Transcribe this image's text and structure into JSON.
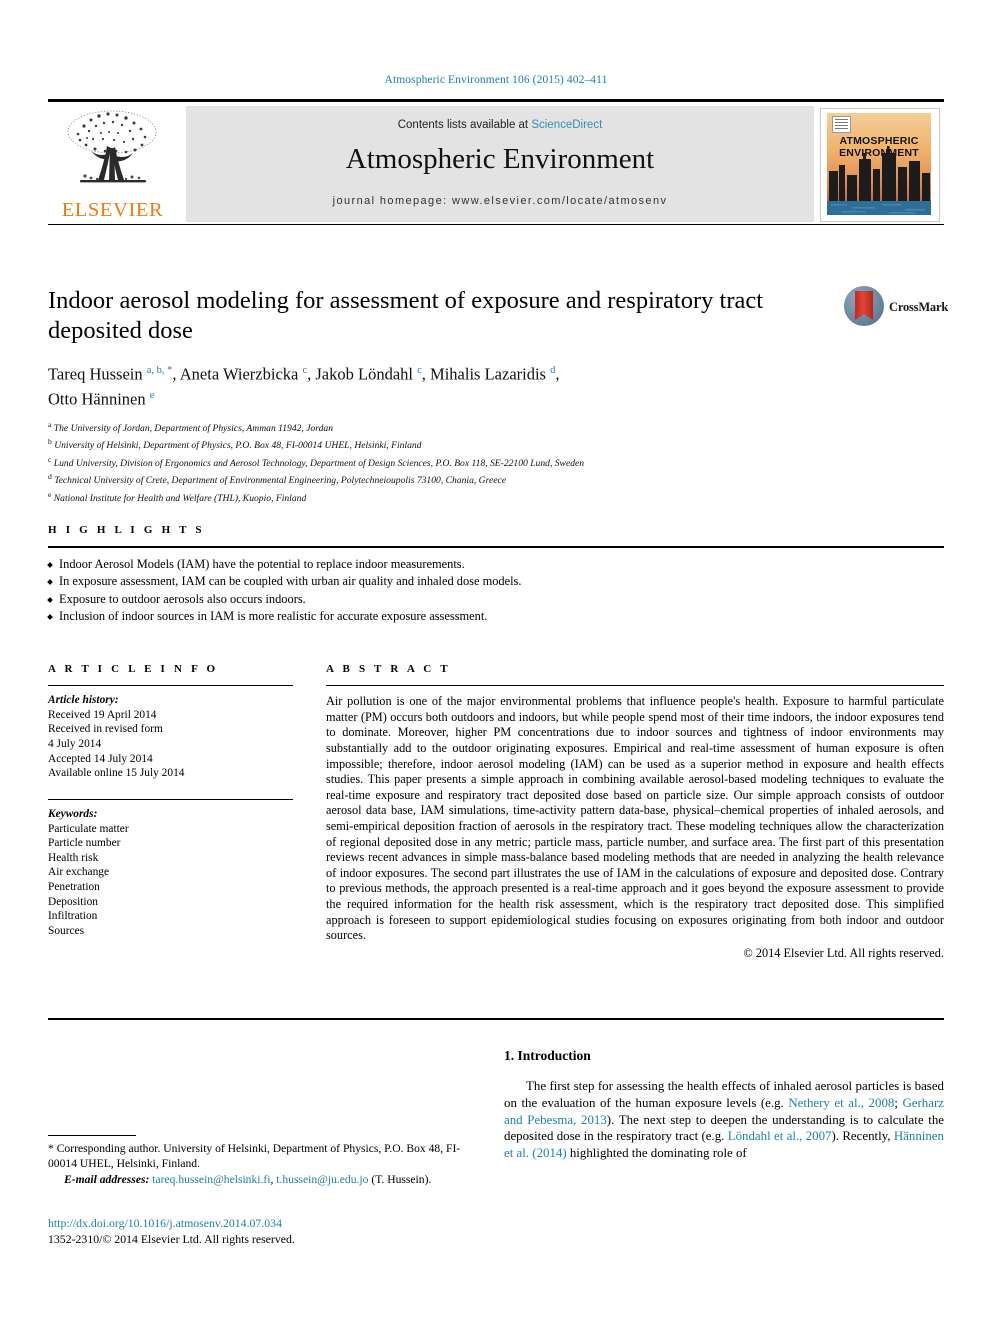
{
  "running_head": "Atmospheric Environment 106 (2015) 402–411",
  "masthead": {
    "publisher_name": "ELSEVIER",
    "contents_prefix": "Contents lists available at ",
    "contents_link": "ScienceDirect",
    "journal_title": "Atmospheric Environment",
    "journal_homepage": "journal homepage: www.elsevier.com/locate/atmosenv",
    "cover_title_line1": "ATMOSPHERIC",
    "cover_title_line2": "ENVIRONMENT"
  },
  "article": {
    "title": "Indoor aerosol modeling for assessment of exposure and respiratory tract deposited dose",
    "crossmark_label": "CrossMark",
    "authors_html": "Tareq Hussein <sup>a, b, *</sup>, Aneta Wierzbicka <sup>c</sup>, Jakob Löndahl <sup>c</sup>, Mihalis Lazaridis <sup>d</sup>,<br>Otto Hänninen <sup>e</sup>",
    "affiliations": [
      {
        "label": "a",
        "text": "The University of Jordan, Department of Physics, Amman 11942, Jordan"
      },
      {
        "label": "b",
        "text": "University of Helsinki, Department of Physics, P.O. Box 48, FI-00014 UHEL, Helsinki, Finland"
      },
      {
        "label": "c",
        "text": "Lund University, Division of Ergonomics and Aerosol Technology, Department of Design Sciences, P.O. Box 118, SE-22100 Lund, Sweden"
      },
      {
        "label": "d",
        "text": "Technical University of Crete, Department of Environmental Engineering, Polytechneioupolis 73100, Chania, Greece"
      },
      {
        "label": "e",
        "text": "National Institute for Health and Welfare (THL), Kuopio, Finland"
      }
    ]
  },
  "highlights": {
    "heading": "H I G H L I G H T S",
    "items": [
      "Indoor Aerosol Models (IAM) have the potential to replace indoor measurements.",
      "In exposure assessment, IAM can be coupled with urban air quality and inhaled dose models.",
      "Exposure to outdoor aerosols also occurs indoors.",
      "Inclusion of indoor sources in IAM is more realistic for accurate exposure assessment."
    ]
  },
  "article_info": {
    "heading": "A R T I C L E   I N F O",
    "history_label": "Article history:",
    "history": [
      "Received 19 April 2014",
      "Received in revised form",
      "4 July 2014",
      "Accepted 14 July 2014",
      "Available online 15 July 2014"
    ],
    "keywords_label": "Keywords:",
    "keywords": [
      "Particulate matter",
      "Particle number",
      "Health risk",
      "Air exchange",
      "Penetration",
      "Deposition",
      "Infiltration",
      "Sources"
    ]
  },
  "abstract": {
    "heading": "A B S T R A C T",
    "text": "Air pollution is one of the major environmental problems that influence people's health. Exposure to harmful particulate matter (PM) occurs both outdoors and indoors, but while people spend most of their time indoors, the indoor exposures tend to dominate. Moreover, higher PM concentrations due to indoor sources and tightness of indoor environments may substantially add to the outdoor originating exposures. Empirical and real-time assessment of human exposure is often impossible; therefore, indoor aerosol modeling (IAM) can be used as a superior method in exposure and health effects studies. This paper presents a simple approach in combining available aerosol-based modeling techniques to evaluate the real-time exposure and respiratory tract deposited dose based on particle size. Our simple approach consists of outdoor aerosol data base, IAM simulations, time-activity pattern data-base, physical–chemical properties of inhaled aerosols, and semi-empirical deposition fraction of aerosols in the respiratory tract. These modeling techniques allow the characterization of regional deposited dose in any metric; particle mass, particle number, and surface area. The first part of this presentation reviews recent advances in simple mass-balance based modeling methods that are needed in analyzing the health relevance of indoor exposures. The second part illustrates the use of IAM in the calculations of exposure and deposited dose. Contrary to previous methods, the approach presented is a real-time approach and it goes beyond the exposure assessment to provide the required information for the health risk assessment, which is the respiratory tract deposited dose. This simplified approach is foreseen to support epidemiological studies focusing on exposures originating from both indoor and outdoor sources.",
    "copyright": "© 2014 Elsevier Ltd. All rights reserved."
  },
  "introduction": {
    "heading": "1.  Introduction",
    "paragraph_html": "The first step for assessing the health effects of inhaled aerosol particles is based on the evaluation of the human exposure levels (e.g. <span class=\"cit\">Nethery et al., 2008</span>; <span class=\"cit\">Gerharz and Pebesma, 2013</span>). The next step to deepen the understanding is to calculate the deposited dose in the respiratory tract (e.g. <span class=\"cit\">Löndahl et al., 2007</span>). Recently, <span class=\"cit\">Hänninen et al. (2014)</span> highlighted the dominating role of"
  },
  "footnotes": {
    "corresponding_html": "* Corresponding author. University of Helsinki, Department of Physics, P.O. Box 48, FI-00014 UHEL, Helsinki, Finland.",
    "email_label": "E-mail addresses:",
    "email_1": "tareq.hussein@helsinki.fi",
    "email_2": "t.hussein@ju.edu.jo",
    "email_suffix": "(T. Hussein).",
    "doi": "http://dx.doi.org/10.1016/j.atmosenv.2014.07.034",
    "issn_line": "1352-2310/© 2014 Elsevier Ltd. All rights reserved."
  },
  "colors": {
    "link_blue": "#1f7fa8",
    "sciencedirect_blue": "#3b8ab8",
    "elsevier_orange": "#ED7B12",
    "band_gray": "#e3e3e3"
  }
}
